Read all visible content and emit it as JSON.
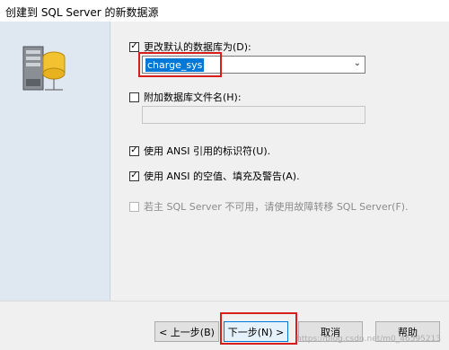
{
  "window": {
    "title": "创建到 SQL Server 的新数据源"
  },
  "options": {
    "change_default_db": {
      "label": "更改默认的数据库为(D):",
      "checked": true
    },
    "database_value": "charge_sys",
    "attach_db_file": {
      "label": "附加数据库文件名(H):",
      "checked": false
    },
    "attach_db_file_value": "",
    "ansi_quoted_identifiers": {
      "label": "使用 ANSI 引用的标识符(U).",
      "checked": true
    },
    "ansi_nulls_padding": {
      "label": "使用 ANSI 的空值、填充及警告(A).",
      "checked": true
    },
    "failover": {
      "label": "若主 SQL Server 不可用，请使用故障转移 SQL Server(F).",
      "checked": false,
      "disabled": true
    }
  },
  "buttons": {
    "back": "< 上一步(B)",
    "next": "下一步(N) >",
    "cancel": "取消",
    "help": "帮助"
  },
  "watermark": "https://blog.csdn.net/m0_46595213",
  "colors": {
    "highlight": "#0078d7",
    "annotation_red": "#d91c1c",
    "side_panel": "#dfe7f1"
  },
  "icons": {
    "server": "server-database-icon",
    "dropdown": "chevron-down-icon"
  }
}
